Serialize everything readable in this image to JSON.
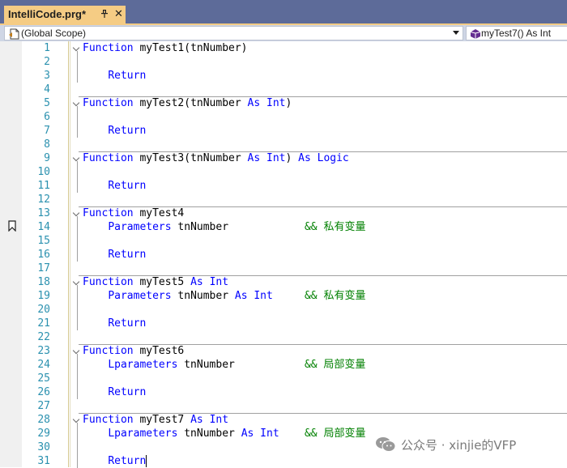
{
  "tab": {
    "title": "IntelliCode.prg*",
    "close_glyph": "✕",
    "active_color": "#f5cc84"
  },
  "nav": {
    "scope": "(Global Scope)",
    "member": "myTest7() As Int"
  },
  "colors": {
    "keyword": "#0000ff",
    "comment": "#008000",
    "line_number": "#2b91af",
    "chrome": "#5d6b99"
  },
  "editor": {
    "lines": [
      {
        "n": "1",
        "segs": [
          {
            "t": "Function",
            "c": "kw"
          },
          {
            "t": " myTest1(tnNumber)"
          }
        ]
      },
      {
        "n": "2",
        "segs": []
      },
      {
        "n": "3",
        "segs": [
          {
            "t": "    "
          },
          {
            "t": "Return",
            "c": "kw"
          }
        ]
      },
      {
        "n": "4",
        "segs": []
      },
      {
        "n": "5",
        "segs": [
          {
            "t": "Function",
            "c": "kw"
          },
          {
            "t": " myTest2(tnNumber "
          },
          {
            "t": "As",
            "c": "kw"
          },
          {
            "t": " "
          },
          {
            "t": "Int",
            "c": "kw"
          },
          {
            "t": ")"
          }
        ]
      },
      {
        "n": "6",
        "segs": []
      },
      {
        "n": "7",
        "segs": [
          {
            "t": "    "
          },
          {
            "t": "Return",
            "c": "kw"
          }
        ]
      },
      {
        "n": "8",
        "segs": []
      },
      {
        "n": "9",
        "segs": [
          {
            "t": "Function",
            "c": "kw"
          },
          {
            "t": " myTest3(tnNumber "
          },
          {
            "t": "As",
            "c": "kw"
          },
          {
            "t": " "
          },
          {
            "t": "Int",
            "c": "kw"
          },
          {
            "t": ") "
          },
          {
            "t": "As",
            "c": "kw"
          },
          {
            "t": " "
          },
          {
            "t": "Logic",
            "c": "kw"
          }
        ]
      },
      {
        "n": "10",
        "segs": []
      },
      {
        "n": "11",
        "segs": [
          {
            "t": "    "
          },
          {
            "t": "Return",
            "c": "kw"
          }
        ]
      },
      {
        "n": "12",
        "segs": []
      },
      {
        "n": "13",
        "segs": [
          {
            "t": "Function",
            "c": "kw"
          },
          {
            "t": " myTest4"
          }
        ]
      },
      {
        "n": "14",
        "segs": [
          {
            "t": "    "
          },
          {
            "t": "Parameters",
            "c": "kw"
          },
          {
            "t": " tnNumber            "
          },
          {
            "t": "&& 私有变量",
            "c": "cm"
          }
        ]
      },
      {
        "n": "15",
        "segs": []
      },
      {
        "n": "16",
        "segs": [
          {
            "t": "    "
          },
          {
            "t": "Return",
            "c": "kw"
          }
        ]
      },
      {
        "n": "17",
        "segs": []
      },
      {
        "n": "18",
        "segs": [
          {
            "t": "Function",
            "c": "kw"
          },
          {
            "t": " myTest5 "
          },
          {
            "t": "As",
            "c": "kw"
          },
          {
            "t": " "
          },
          {
            "t": "Int",
            "c": "kw"
          }
        ]
      },
      {
        "n": "19",
        "segs": [
          {
            "t": "    "
          },
          {
            "t": "Parameters",
            "c": "kw"
          },
          {
            "t": " tnNumber "
          },
          {
            "t": "As",
            "c": "kw"
          },
          {
            "t": " "
          },
          {
            "t": "Int",
            "c": "kw"
          },
          {
            "t": "     "
          },
          {
            "t": "&& 私有变量",
            "c": "cm"
          }
        ]
      },
      {
        "n": "20",
        "segs": []
      },
      {
        "n": "21",
        "segs": [
          {
            "t": "    "
          },
          {
            "t": "Return",
            "c": "kw"
          }
        ]
      },
      {
        "n": "22",
        "segs": []
      },
      {
        "n": "23",
        "segs": [
          {
            "t": "Function",
            "c": "kw"
          },
          {
            "t": " myTest6"
          }
        ]
      },
      {
        "n": "24",
        "segs": [
          {
            "t": "    "
          },
          {
            "t": "Lparameters",
            "c": "kw"
          },
          {
            "t": " tnNumber           "
          },
          {
            "t": "&& 局部变量",
            "c": "cm"
          }
        ]
      },
      {
        "n": "25",
        "segs": []
      },
      {
        "n": "26",
        "segs": [
          {
            "t": "    "
          },
          {
            "t": "Return",
            "c": "kw"
          }
        ]
      },
      {
        "n": "27",
        "segs": []
      },
      {
        "n": "28",
        "segs": [
          {
            "t": "Function",
            "c": "kw"
          },
          {
            "t": " myTest7 "
          },
          {
            "t": "As",
            "c": "kw"
          },
          {
            "t": " "
          },
          {
            "t": "Int",
            "c": "kw"
          }
        ]
      },
      {
        "n": "29",
        "segs": [
          {
            "t": "    "
          },
          {
            "t": "Lparameters",
            "c": "kw"
          },
          {
            "t": " tnNumber "
          },
          {
            "t": "As",
            "c": "kw"
          },
          {
            "t": " "
          },
          {
            "t": "Int",
            "c": "kw"
          },
          {
            "t": "    "
          },
          {
            "t": "&& 局部变量",
            "c": "cm"
          }
        ]
      },
      {
        "n": "30",
        "segs": []
      },
      {
        "n": "31",
        "segs": [
          {
            "t": "    "
          },
          {
            "t": "Return",
            "c": "kw"
          }
        ]
      }
    ],
    "function_start_lines": [
      "1",
      "5",
      "9",
      "13",
      "18",
      "23",
      "28"
    ],
    "bookmark_line": "14",
    "caret_line": "31"
  },
  "watermark": {
    "text": "公众号 · xinjie的VFP",
    "icon": "wechat-icon"
  }
}
